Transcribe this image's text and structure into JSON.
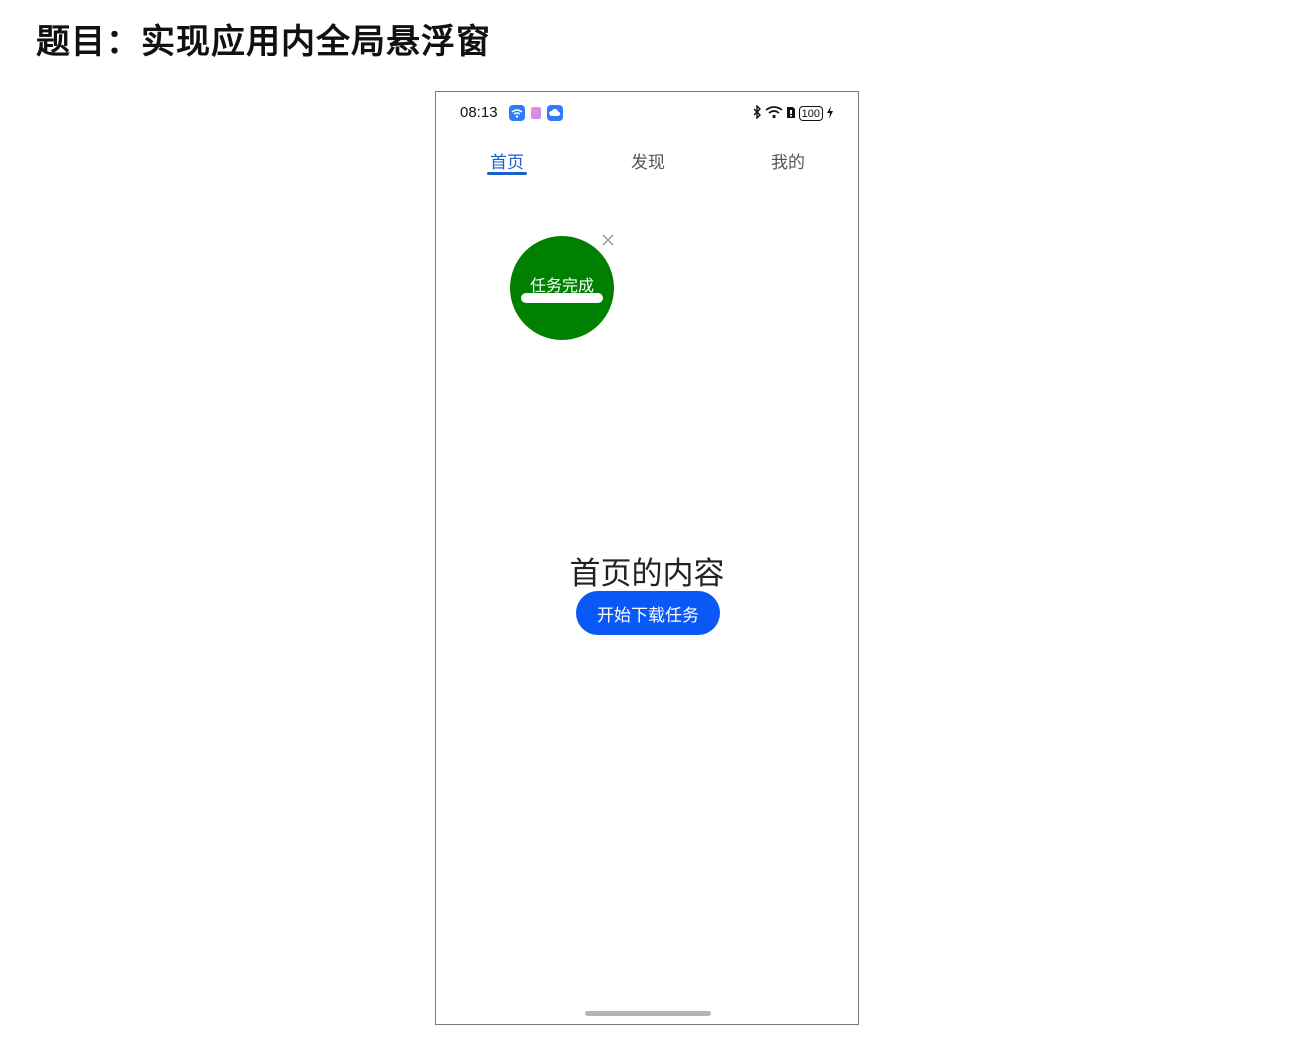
{
  "page": {
    "title": "题目：实现应用内全局悬浮窗"
  },
  "status_bar": {
    "time": "08:13",
    "battery": "100"
  },
  "tabs": [
    {
      "label": "首页",
      "active": true
    },
    {
      "label": "发现",
      "active": false
    },
    {
      "label": "我的",
      "active": false
    }
  ],
  "floating_window": {
    "label": "任务完成",
    "progress": 1.0,
    "color": "#008000"
  },
  "main": {
    "content_text": "首页的内容",
    "start_button_label": "开始下载任务"
  },
  "colors": {
    "accent": "#1a5fd0",
    "button": "#0a59f7"
  }
}
